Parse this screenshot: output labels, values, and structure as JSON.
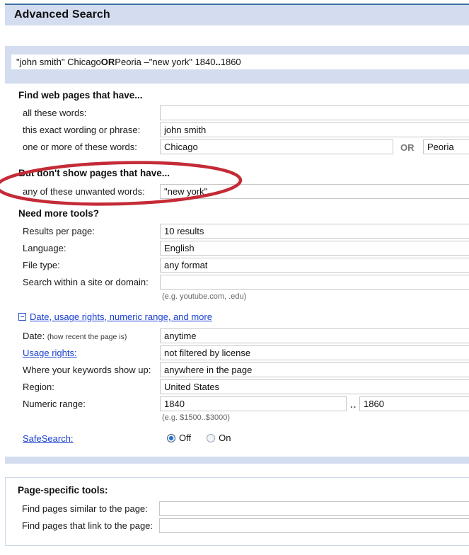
{
  "header": {
    "title": "Advanced Search"
  },
  "query_bar": {
    "name": "search-query",
    "parts": [
      {
        "text": "\"john smith\" Chicago ",
        "bold": false
      },
      {
        "text": "OR",
        "bold": true
      },
      {
        "text": " Peoria –\"new york\" 1840",
        "bold": false
      },
      {
        "text": "..",
        "bold": true
      },
      {
        "text": "1860",
        "bold": false
      }
    ],
    "plain": "\"john smith\" Chicago OR Peoria –\"new york\" 1840..1860"
  },
  "sections": {
    "find": {
      "heading": "Find web pages that have...",
      "rows": [
        {
          "label": "all these words:",
          "value": ""
        },
        {
          "label": "this exact wording or phrase:",
          "value": "john smith"
        },
        {
          "label": "one or more of these words:",
          "value": "Chicago",
          "separator": "OR",
          "value2": "Peoria"
        }
      ]
    },
    "exclude": {
      "heading": "But don't show pages that have...",
      "rows": [
        {
          "label": "any of these unwanted words:",
          "value": "\"new york\""
        }
      ]
    },
    "tools": {
      "heading": "Need more tools?",
      "rows": [
        {
          "label": "Results per page:",
          "value": "10 results"
        },
        {
          "label": "Language:",
          "value": "English"
        },
        {
          "label": "File type:",
          "value": "any format"
        },
        {
          "label": "Search within a site or domain:",
          "value": "",
          "hint": "(e.g. youtube.com, .edu)"
        }
      ]
    },
    "more": {
      "expander_label": "Date, usage rights, numeric range, and more",
      "expander_icon": "collapse-minus-icon",
      "rows": [
        {
          "label": "Date:",
          "label_sub": "(how recent the page is)",
          "value": "anytime"
        },
        {
          "label": "Usage rights:",
          "is_link": true,
          "value": "not filtered by license"
        },
        {
          "label": "Where your keywords show up:",
          "value": "anywhere in the page"
        },
        {
          "label": "Region:",
          "value": "United States"
        },
        {
          "label": "Numeric range:",
          "value": "1840",
          "separator": "..",
          "value2": "1860",
          "hint": "(e.g. $1500..$3000)"
        }
      ],
      "safesearch": {
        "label": "SafeSearch:",
        "is_link": true,
        "options": [
          {
            "text": "Off",
            "selected": true
          },
          {
            "text": "On",
            "selected": false
          }
        ]
      }
    },
    "page_specific": {
      "heading": "Page-specific tools:",
      "rows": [
        {
          "label": "Find pages similar to the page:",
          "value": ""
        },
        {
          "label": "Find pages that link to the page:",
          "value": ""
        }
      ]
    }
  },
  "annotation": {
    "type": "red-ellipse-highlight",
    "color": "#c42b36",
    "targets": "But don't show pages that have... / any of these unwanted words"
  },
  "colors": {
    "band": "#d4dcf0",
    "accent_border": "#3b6ea5",
    "link": "#1a3fd0",
    "annotation_red": "#c42b36"
  }
}
